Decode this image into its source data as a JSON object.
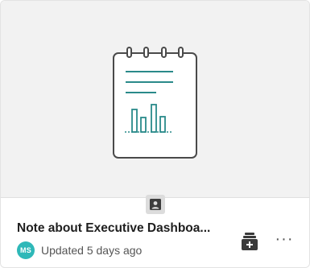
{
  "card": {
    "title": "Note about Executive Dashboa...",
    "owner_initials": "MS",
    "updated_text": "Updated 5 days ago",
    "thumbnail_icon": "notepad-chart-icon",
    "type_icon": "person-badge-icon",
    "actions": {
      "add_to_collection_icon": "add-to-collection-icon",
      "more_icon": "more-options-icon",
      "more_glyph": "···"
    }
  },
  "colors": {
    "accent": "#2a8a8a",
    "avatar": "#2eb8b8",
    "thumbnail_bg": "#f2f2f2"
  }
}
